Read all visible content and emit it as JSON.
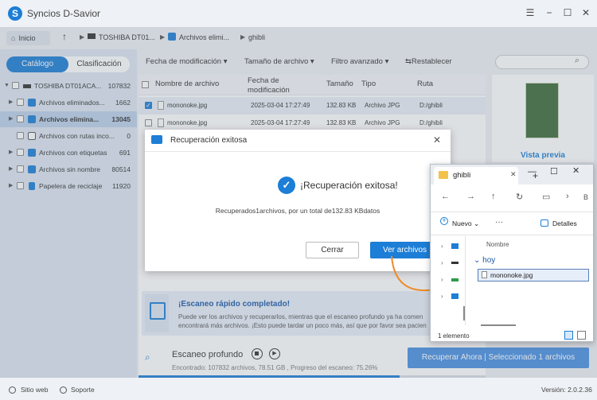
{
  "app": {
    "title": "Syncios D-Savior",
    "logo_letter": "S",
    "version": "Versión: 2.0.2.36"
  },
  "window_controls": {
    "menu": "☰",
    "minimize": "−",
    "maximize": "☐",
    "close": "✕"
  },
  "nav": {
    "home": "Inicio",
    "up": "↑",
    "breadcrumbs": [
      "TOSHIBA DT01...",
      "Archivos elimi...",
      "ghibli"
    ],
    "sep": "▶"
  },
  "sidebar": {
    "tabs": [
      "Catálogo",
      "Clasificación"
    ],
    "items": [
      {
        "label": "TOSHIBA DT01ACA...",
        "count": "107832"
      },
      {
        "label": "Archivos eliminados...",
        "count": "1662"
      },
      {
        "label": "Archivos elimina...",
        "count": "13045"
      },
      {
        "label": "Archivos con rutas inco...",
        "count": "0"
      },
      {
        "label": "Archivos con etiquetas",
        "count": "691"
      },
      {
        "label": "Archivos sin nombre",
        "count": "80514"
      },
      {
        "label": "Papelera de reciclaje",
        "count": "11920"
      }
    ]
  },
  "filters": {
    "date": "Fecha de modificación",
    "size": "Tamaño de archivo",
    "advanced": "Filtro avanzado",
    "reset": "Restablecer",
    "caret": "▾",
    "reset_icon": "⇆"
  },
  "search": {
    "icon": "⌕"
  },
  "table": {
    "headers": {
      "name": "Nombre de archivo",
      "date1": "Fecha de",
      "date2": "modificación",
      "size": "Tamaño",
      "type": "Tipo",
      "path": "Ruta"
    },
    "rows": [
      {
        "name": "mononoke.jpg",
        "date": "2025-03-04 17:27:49",
        "size": "132.83 KB",
        "type": "Archivo JPG",
        "path": "D:/ghibli",
        "checked": true
      },
      {
        "name": "mononoke.jpg",
        "date": "2025-03-04 17:27:49",
        "size": "132.83 KB",
        "type": "Archivo JPG",
        "path": "D:/ghibli",
        "checked": false
      }
    ]
  },
  "preview": {
    "label": "Vista previa"
  },
  "quick_scan": {
    "title": "¡Escaneo rápido completado!",
    "desc1": "Puede ver los archivos y recuperarlos, mientras que el escaneo profundo ya ha comen",
    "desc2": "encontrará más archivos. ¡Esto puede tardar un poco más, así que por favor sea pacien"
  },
  "deep_scan": {
    "title": "Escaneo profundo",
    "progress_text": "Encontrado: 107832 archivos, 78.51 GB , Progreso del escaneo: 75.26%",
    "progress": 0.7526,
    "play": "▶"
  },
  "recover_button": "Recuperar Ahora | Seleccionado 1 archivos",
  "status": {
    "web": "Sitio web",
    "support": "Soporte"
  },
  "dialog": {
    "title": "Recuperación exitosa",
    "close": "✕",
    "check": "✓",
    "message": "¡Recuperación exitosa!",
    "detail": "Recuperados1archivos, por un total de132.83 KBdatos",
    "cancel": "Cerrar",
    "view": "Ver archivos"
  },
  "explorer": {
    "tab_title": "ghibli",
    "tab_close": "✕",
    "new_tab": "+",
    "min": "—",
    "max": "☐",
    "close": "✕",
    "nav": {
      "back": "←",
      "forward": "→",
      "up": "↑",
      "refresh": "↻",
      "view": "▭",
      "chev": "›",
      "cut": "B"
    },
    "new": "Nuevo",
    "new_caret": "⌄",
    "more": "···",
    "details": "Detalles",
    "column": "Nombre",
    "group": "hoy",
    "group_caret": "⌄",
    "file": "mononoke.jpg",
    "status": "1 elemento",
    "tree_chev": "›"
  },
  "colors": {
    "accent": "#1c7ed6",
    "sidebar": "#dce5f0",
    "selected": "#bcd0ea"
  }
}
